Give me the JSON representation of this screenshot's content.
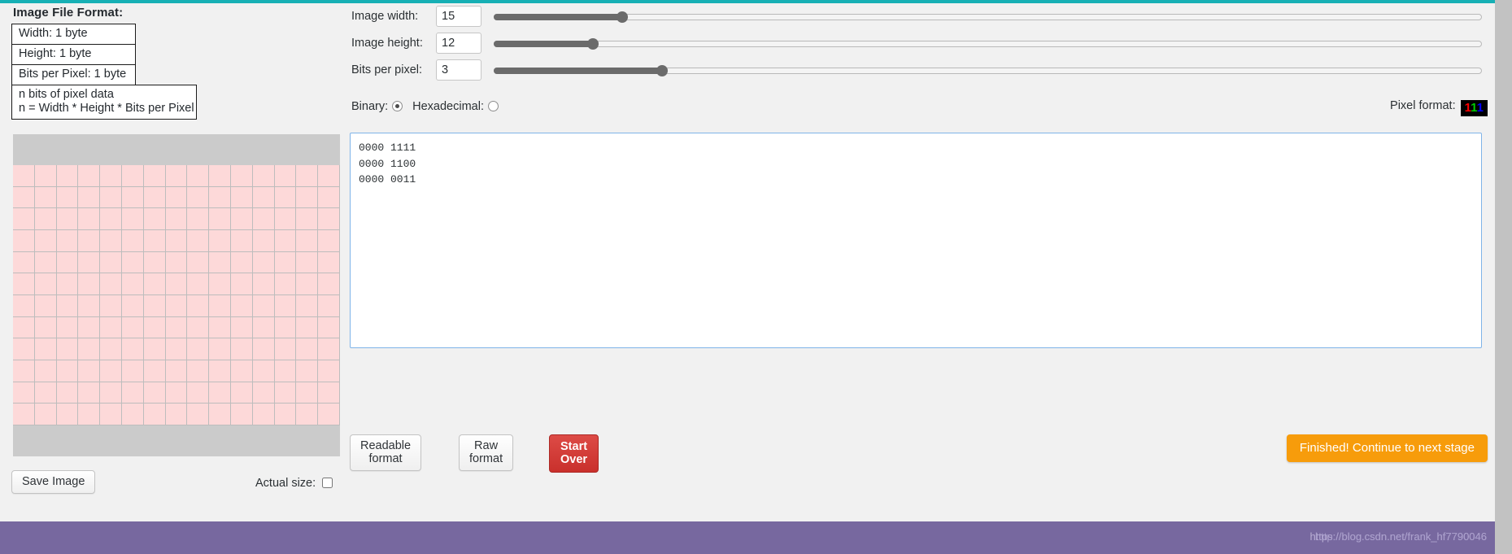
{
  "format_panel": {
    "title": "Image File Format:",
    "rows": [
      "Width: 1 byte",
      "Height: 1 byte",
      "Bits per Pixel: 1 byte"
    ],
    "data_row_line1": "n bits of pixel data",
    "data_row_line2": "n = Width * Height * Bits per Pixel"
  },
  "controls": {
    "width": {
      "label": "Image width:",
      "value": "15",
      "fill_percent": 13
    },
    "height": {
      "label": "Image height:",
      "value": "12",
      "fill_percent": 10
    },
    "bpp": {
      "label": "Bits per pixel:",
      "value": "3",
      "fill_percent": 17
    }
  },
  "mode": {
    "binary_label": "Binary:",
    "hex_label": "Hexadecimal:",
    "selected": "binary"
  },
  "pixel_format": {
    "label": "Pixel format:",
    "red_digit": "1",
    "green_digit": "1",
    "blue_digit": "1",
    "background": "#000000",
    "red_color": "#ff0000",
    "green_color": "#00cc00",
    "blue_color": "#0000ff"
  },
  "editor": {
    "value": "0000 1111\n0000 1100\n0000 0011",
    "placeholder": ""
  },
  "canvas": {
    "columns": 15,
    "rows": 12,
    "cell_color": "#fdd9d9",
    "band_color": "#cbcbcb",
    "grid_line_color": "#bdbdbd"
  },
  "buttons": {
    "save_image": "Save Image",
    "actual_size_label": "Actual size:",
    "actual_size_checked": false,
    "readable_format": "Readable format",
    "raw_format": "Raw format",
    "start_over": "Start Over",
    "finish": "Finished! Continue to next stage"
  },
  "theme": {
    "top_rule": "#17b0b5",
    "footer": "#77689f",
    "danger": "#c9302c",
    "accent_orange": "#f79c0b",
    "focus_blue": "#7fb4e8"
  },
  "footer": {
    "watermark_a": "https://blog.csdn.net/frank_hf7790046",
    "watermark_b": "http://blog.csdn.net/frank_hf7790046"
  }
}
